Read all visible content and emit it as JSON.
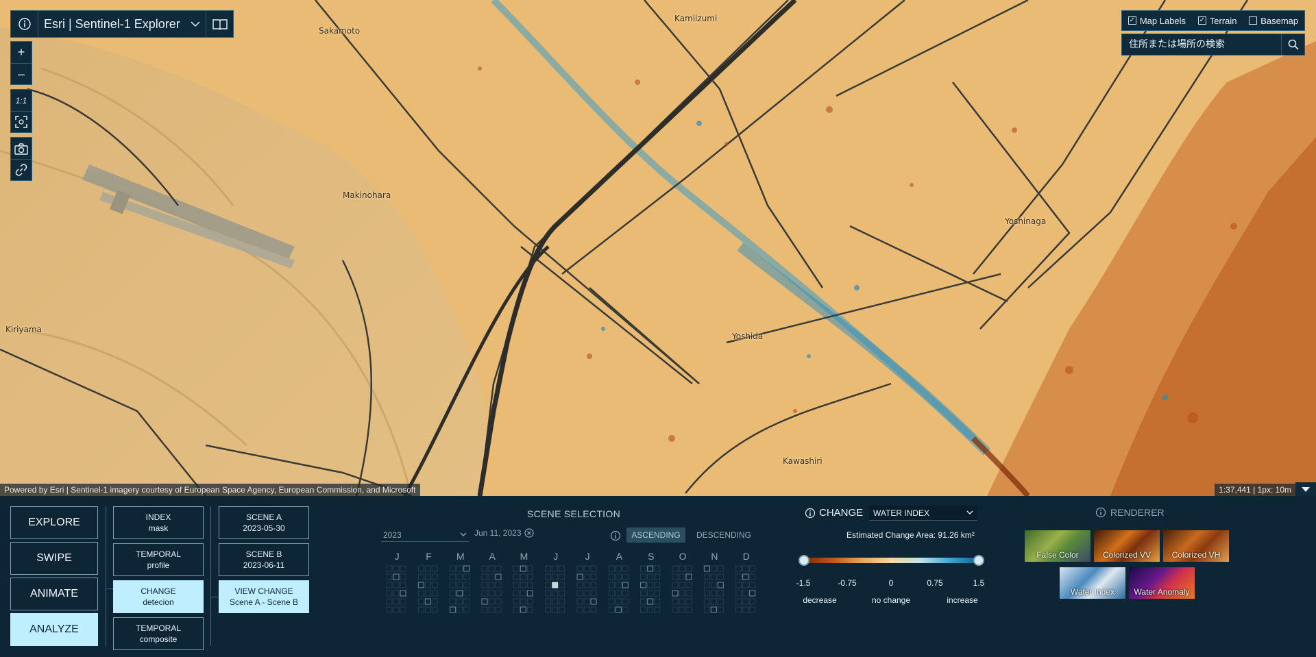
{
  "app": {
    "title": "Esri | Sentinel-1 Explorer"
  },
  "map": {
    "place_labels": [
      "Sakamoto",
      "Kamiizumi",
      "Makinohara",
      "Yoshinaga",
      "Kiriyama",
      "Yoshida",
      "Kawashiri"
    ],
    "zoom_in": "+",
    "zoom_out": "–",
    "scale_1to1": "1:1",
    "attribution": "Powered by Esri | Sentinel-1 imagery courtesy of European Space Agency, European Commission, and Microsoft",
    "scale_readout": "1:37,441 | 1px: 10m"
  },
  "layers": {
    "map_labels": "Map Labels",
    "terrain": "Terrain",
    "basemap": "Basemap",
    "map_labels_checked": true,
    "terrain_checked": true,
    "basemap_checked": false
  },
  "search": {
    "placeholder": "住所または場所の検索"
  },
  "modes": {
    "explore": "EXPLORE",
    "swipe": "SWIPE",
    "animate": "ANIMATE",
    "analyze": "ANALYZE",
    "active": "ANALYZE"
  },
  "tools": {
    "index_title": "INDEX",
    "index_sub": "mask",
    "temporal_profile_title": "TEMPORAL",
    "temporal_profile_sub": "profile",
    "change_title": "CHANGE",
    "change_sub": "detecion",
    "temporal_composite_title": "TEMPORAL",
    "temporal_composite_sub": "composite"
  },
  "scenes": {
    "scene_a_title": "SCENE A",
    "scene_a_date": "2023-05-30",
    "scene_b_title": "SCENE B",
    "scene_b_date": "2023-06-11",
    "view_change_title": "VIEW CHANGE",
    "view_change_sub": "Scene A - Scene B"
  },
  "scene_selection": {
    "title": "SCENE SELECTION",
    "year": "2023",
    "selected_date": "Jun 11, 2023",
    "ascending": "ASCENDING",
    "descending": "DESCENDING",
    "months": [
      "J",
      "F",
      "M",
      "A",
      "M",
      "J",
      "J",
      "A",
      "S",
      "O",
      "N",
      "D"
    ]
  },
  "change": {
    "title": "CHANGE",
    "index": "WATER INDEX",
    "estimated_area": "Estimated Change Area: 91.26 km²",
    "ticks": [
      "-1.5",
      "-0.75",
      "0",
      "0.75",
      "1.5"
    ],
    "label_decrease": "decrease",
    "label_no_change": "no change",
    "label_increase": "increase",
    "range": [
      -1.5,
      1.5
    ]
  },
  "renderer": {
    "title": "RENDERER",
    "items": [
      "False Color",
      "Colorized VV",
      "Colorized VH",
      "Water Index",
      "Water Anomaly"
    ]
  },
  "colors": {
    "panel_bg": "#0e2535",
    "accent": "#bfeeff",
    "map_base": "#e8b870"
  }
}
